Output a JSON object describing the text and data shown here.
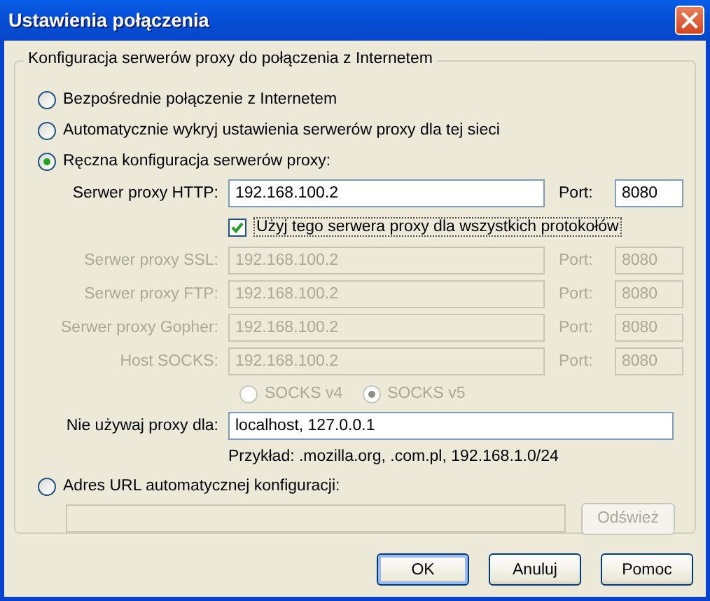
{
  "window": {
    "title": "Ustawienia połączenia"
  },
  "group": {
    "legend": "Konfiguracja serwerów proxy do połączenia z Internetem"
  },
  "connection_modes": [
    {
      "label": "Bezpośrednie połączenie z Internetem",
      "selected": false
    },
    {
      "label": "Automatycznie wykryj ustawienia serwerów proxy dla tej sieci",
      "selected": false
    },
    {
      "label": "Ręczna konfiguracja serwerów proxy:",
      "selected": true
    },
    {
      "label": "Adres URL automatycznej konfiguracji:",
      "selected": false
    }
  ],
  "http_proxy": {
    "label": "Serwer proxy HTTP:",
    "value": "192.168.100.2",
    "port_label": "Port:",
    "port": "8080",
    "disabled": false
  },
  "share_proxy": {
    "label": "Użyj tego serwera proxy dla wszystkich protokołów",
    "checked": true
  },
  "protocol_proxies": [
    {
      "label": "Serwer proxy SSL:",
      "value": "192.168.100.2",
      "port_label": "Port:",
      "port": "8080",
      "disabled": true
    },
    {
      "label": "Serwer proxy FTP:",
      "value": "192.168.100.2",
      "port_label": "Port:",
      "port": "8080",
      "disabled": true
    },
    {
      "label": "Serwer proxy Gopher:",
      "value": "192.168.100.2",
      "port_label": "Port:",
      "port": "8080",
      "disabled": true
    },
    {
      "label": "Host SOCKS:",
      "value": "192.168.100.2",
      "port_label": "Port:",
      "port": "8080",
      "disabled": true
    }
  ],
  "socks_versions": [
    {
      "label": "SOCKS v4",
      "selected": false,
      "disabled": true
    },
    {
      "label": "SOCKS v5",
      "selected": true,
      "disabled": true
    }
  ],
  "no_proxy": {
    "label": "Nie używaj proxy dla:",
    "value": "localhost, 127.0.0.1"
  },
  "example": "Przykład: .mozilla.org, .com.pl, 192.168.1.0/24",
  "auto_config": {
    "disabled": true,
    "reload_button": {
      "label": "Odśwież",
      "disabled": true
    }
  },
  "buttons": [
    {
      "label": "OK",
      "default": true
    },
    {
      "label": "Anuluj",
      "default": false
    },
    {
      "label": "Pomoc",
      "default": false
    }
  ]
}
